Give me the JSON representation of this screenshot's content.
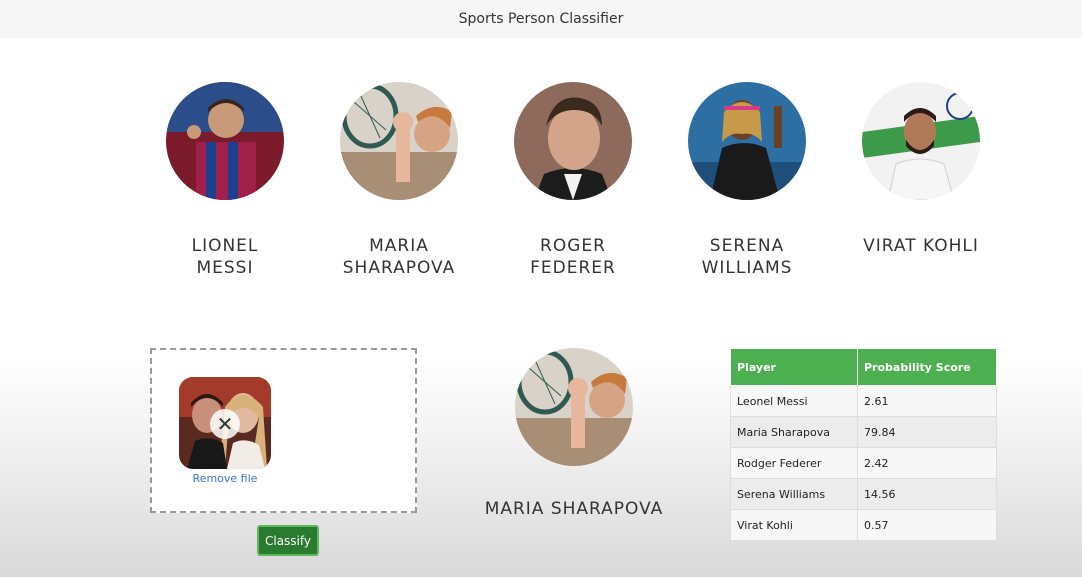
{
  "header": {
    "title": "Sports Person Classifier"
  },
  "players": [
    {
      "line1": "LIONEL",
      "line2": "MESSI",
      "avatar": "lionel-messi"
    },
    {
      "line1": "MARIA",
      "line2": "SHARAPOVA",
      "avatar": "maria-sharapova"
    },
    {
      "line1": "ROGER",
      "line2": "FEDERER",
      "avatar": "roger-federer"
    },
    {
      "line1": "SERENA",
      "line2": "WILLIAMS",
      "avatar": "serena-williams"
    },
    {
      "line1": "VIRAT KOHLI",
      "line2": "",
      "avatar": "virat-kohli"
    }
  ],
  "upload": {
    "remove_label": "Remove file"
  },
  "classify_label": "Classify",
  "result": {
    "name": "MARIA SHARAPOVA"
  },
  "table": {
    "headers": [
      "Player",
      "Probability Score"
    ],
    "rows": [
      [
        "Leonel Messi",
        "2.61"
      ],
      [
        "Maria Sharapova",
        "79.84"
      ],
      [
        "Rodger Federer",
        "2.42"
      ],
      [
        "Serena Williams",
        "14.56"
      ],
      [
        "Virat Kohli",
        "0.57"
      ]
    ]
  },
  "colors": {
    "table_header": "#4caf50",
    "button": "#2a7a2f",
    "link": "#3a76c4"
  }
}
